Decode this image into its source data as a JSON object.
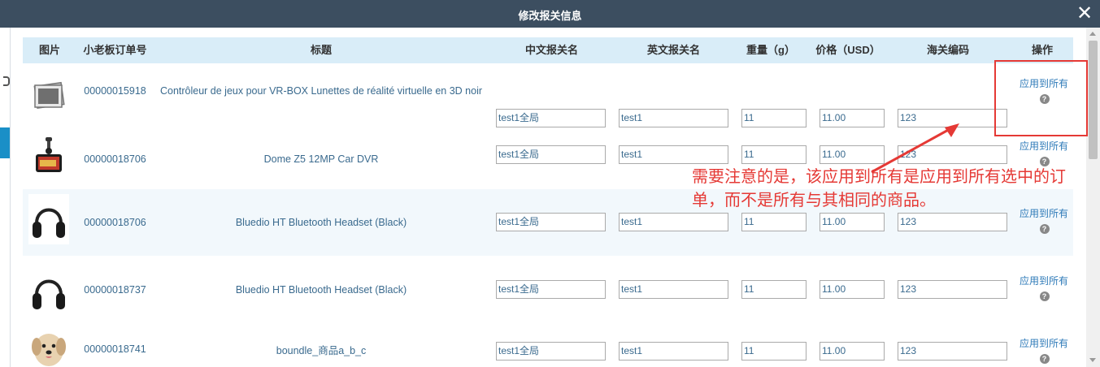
{
  "dialog": {
    "title": "修改报关信息",
    "close_glyph": "✕"
  },
  "table": {
    "headers": {
      "image": "图片",
      "order_no": "小老板订单号",
      "title": "标题",
      "cn_name": "中文报关名",
      "en_name": "英文报关名",
      "weight": "重量（g）",
      "price": "价格（USD）",
      "hs_code": "海关编码",
      "action": "操作"
    },
    "rows": [
      {
        "image": "photo-placeholder",
        "order_no": "00000015918",
        "title": "Contrôleur de jeux pour VR-BOX Lunettes de réalité virtuelle en 3D noir",
        "cn_name": "test1全局",
        "en_name": "test1",
        "weight": "11",
        "price": "11.00",
        "hs_code": "123",
        "action": "应用到所有",
        "help": "?"
      },
      {
        "image": "car-dvr",
        "order_no": "00000018706",
        "title": "Dome Z5 12MP Car DVR",
        "cn_name": "test1全局",
        "en_name": "test1",
        "weight": "11",
        "price": "11.00",
        "hs_code": "123",
        "action": "应用到所有",
        "help": "?"
      },
      {
        "image": "headset",
        "order_no": "00000018706",
        "title": "Bluedio HT Bluetooth Headset (Black)",
        "cn_name": "test1全局",
        "en_name": "test1",
        "weight": "11",
        "price": "11.00",
        "hs_code": "123",
        "action": "应用到所有",
        "help": "?"
      },
      {
        "image": "headset",
        "order_no": "00000018737",
        "title": "Bluedio HT Bluetooth Headset (Black)",
        "cn_name": "test1全局",
        "en_name": "test1",
        "weight": "11",
        "price": "11.00",
        "hs_code": "123",
        "action": "应用到所有",
        "help": "?"
      },
      {
        "image": "dog",
        "order_no": "00000018741",
        "title": "boundle_商品a_b_c",
        "cn_name": "test1全局",
        "en_name": "test1",
        "weight": "11",
        "price": "11.00",
        "hs_code": "123",
        "action": "应用到所有",
        "help": "?"
      }
    ]
  },
  "annotation": {
    "text": "需要注意的是，该应用到所有是应用到所有选中的订单，而不是所有与其相同的商品。",
    "color": "#e53935"
  },
  "colors": {
    "titlebar": "#3c4e60",
    "header_bg": "#d9edf8",
    "link": "#2e7ab8",
    "accent": "#1a8fc7"
  }
}
